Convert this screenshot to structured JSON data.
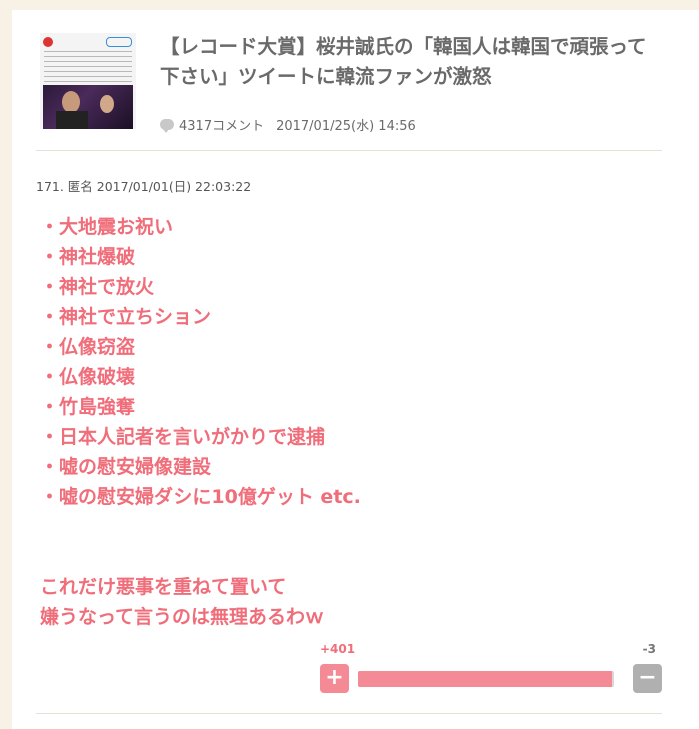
{
  "article": {
    "title": "【レコード大賞】桜井誠氏の「韓国人は韓国で頑張って下さい」ツイートに韓流ファンが激怒",
    "comment_count": "4317コメント",
    "date": "2017/01/25(水) 14:56"
  },
  "comment": {
    "header": "171. 匿名 2017/01/01(日) 22:03:22",
    "list_lines": [
      "・大地震お祝い",
      "・神社爆破",
      "・神社で放火",
      "・神社で立ちション",
      "・仏像窃盗",
      "・仏像破壊",
      "・竹島強奪",
      "・日本人記者を言いがかりで逮捕",
      "・嘘の慰安婦像建設",
      "・嘘の慰安婦ダシに10億ゲット etc."
    ],
    "closing_lines": [
      "これだけ悪事を重ねて置いて",
      "嫌うなって言うのは無理あるわｗ"
    ]
  },
  "vote": {
    "plus_count": "+401",
    "minus_count": "-3",
    "plus_label": "+",
    "minus_label": "−",
    "plus_ratio": 0.993
  },
  "colors": {
    "accent": "#f06d7a",
    "plus_button": "#f48a96",
    "minus_button": "#b0b0b0",
    "background": "#f7f1e6"
  }
}
